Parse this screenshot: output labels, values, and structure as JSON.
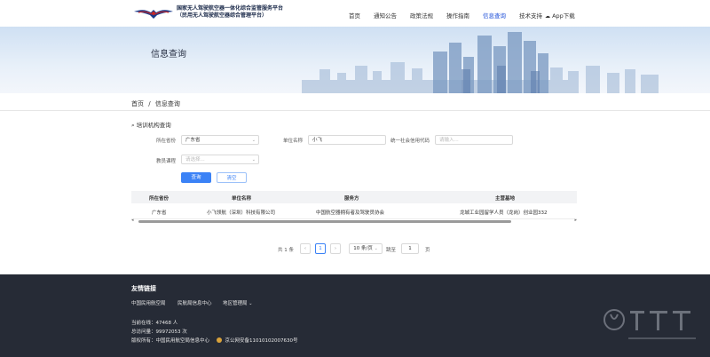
{
  "header": {
    "title_line1": "国家无人驾驶航空器一体化综合监管服务平台",
    "title_line2": "（民用无人驾驶航空器综合管理平台）",
    "nav": [
      "首页",
      "通知公告",
      "政策法规",
      "操作指南",
      "信息查询",
      "技术支持"
    ],
    "active_nav": "信息查询",
    "app_download": "App下载"
  },
  "hero": {
    "title": "信息查询"
  },
  "breadcrumb": {
    "home": "首页",
    "sep": "/",
    "current": "信息查询"
  },
  "search": {
    "section_title": "培训机构查询",
    "province_label": "所在省份",
    "province_value": "广东省",
    "unit_label": "单位名称",
    "unit_value": "小飞",
    "credit_label": "统一社会信用代码",
    "credit_placeholder": "请输入...",
    "course_label": "教员课程",
    "course_placeholder": "请选择...",
    "search_button": "查询",
    "clear_button": "清空"
  },
  "table": {
    "columns": [
      "所在省份",
      "单位名称",
      "服务方",
      "主营基地"
    ],
    "rows": [
      [
        "广东省",
        "小飞领航（深圳）科技有限公司",
        "中国航空器拥有者及驾驶员协会",
        "龙城工业园留学人员（龙岗）创业园332"
      ]
    ]
  },
  "pagination": {
    "total": "共 1 条",
    "prev": "‹",
    "current_page": "1",
    "next": "›",
    "page_size": "10 条/页",
    "goto_label": "跳至",
    "goto_value": "1",
    "page_suffix": "页"
  },
  "footer": {
    "links_title": "友情链接",
    "links": [
      "中国民用航空局",
      "民航局信息中心",
      "地区管理局"
    ],
    "online_label": "当前在线：",
    "online_value": "47468 人",
    "visits_label": "总访问量：",
    "visits_value": "99972053 次",
    "copyright": "版权所有：中国民用航空局信息中心",
    "icp": "京公网安备11010102007630号"
  },
  "colors": {
    "primary": "#3b82f6",
    "nav_active": "#1d4ed8",
    "footer_bg": "#262b36",
    "hero_bg": "#cfe0f3"
  },
  "icons": [
    "logo-wings",
    "cloud-download-icon",
    "search-icon",
    "chevron-down-icon",
    "police-badge-icon"
  ]
}
